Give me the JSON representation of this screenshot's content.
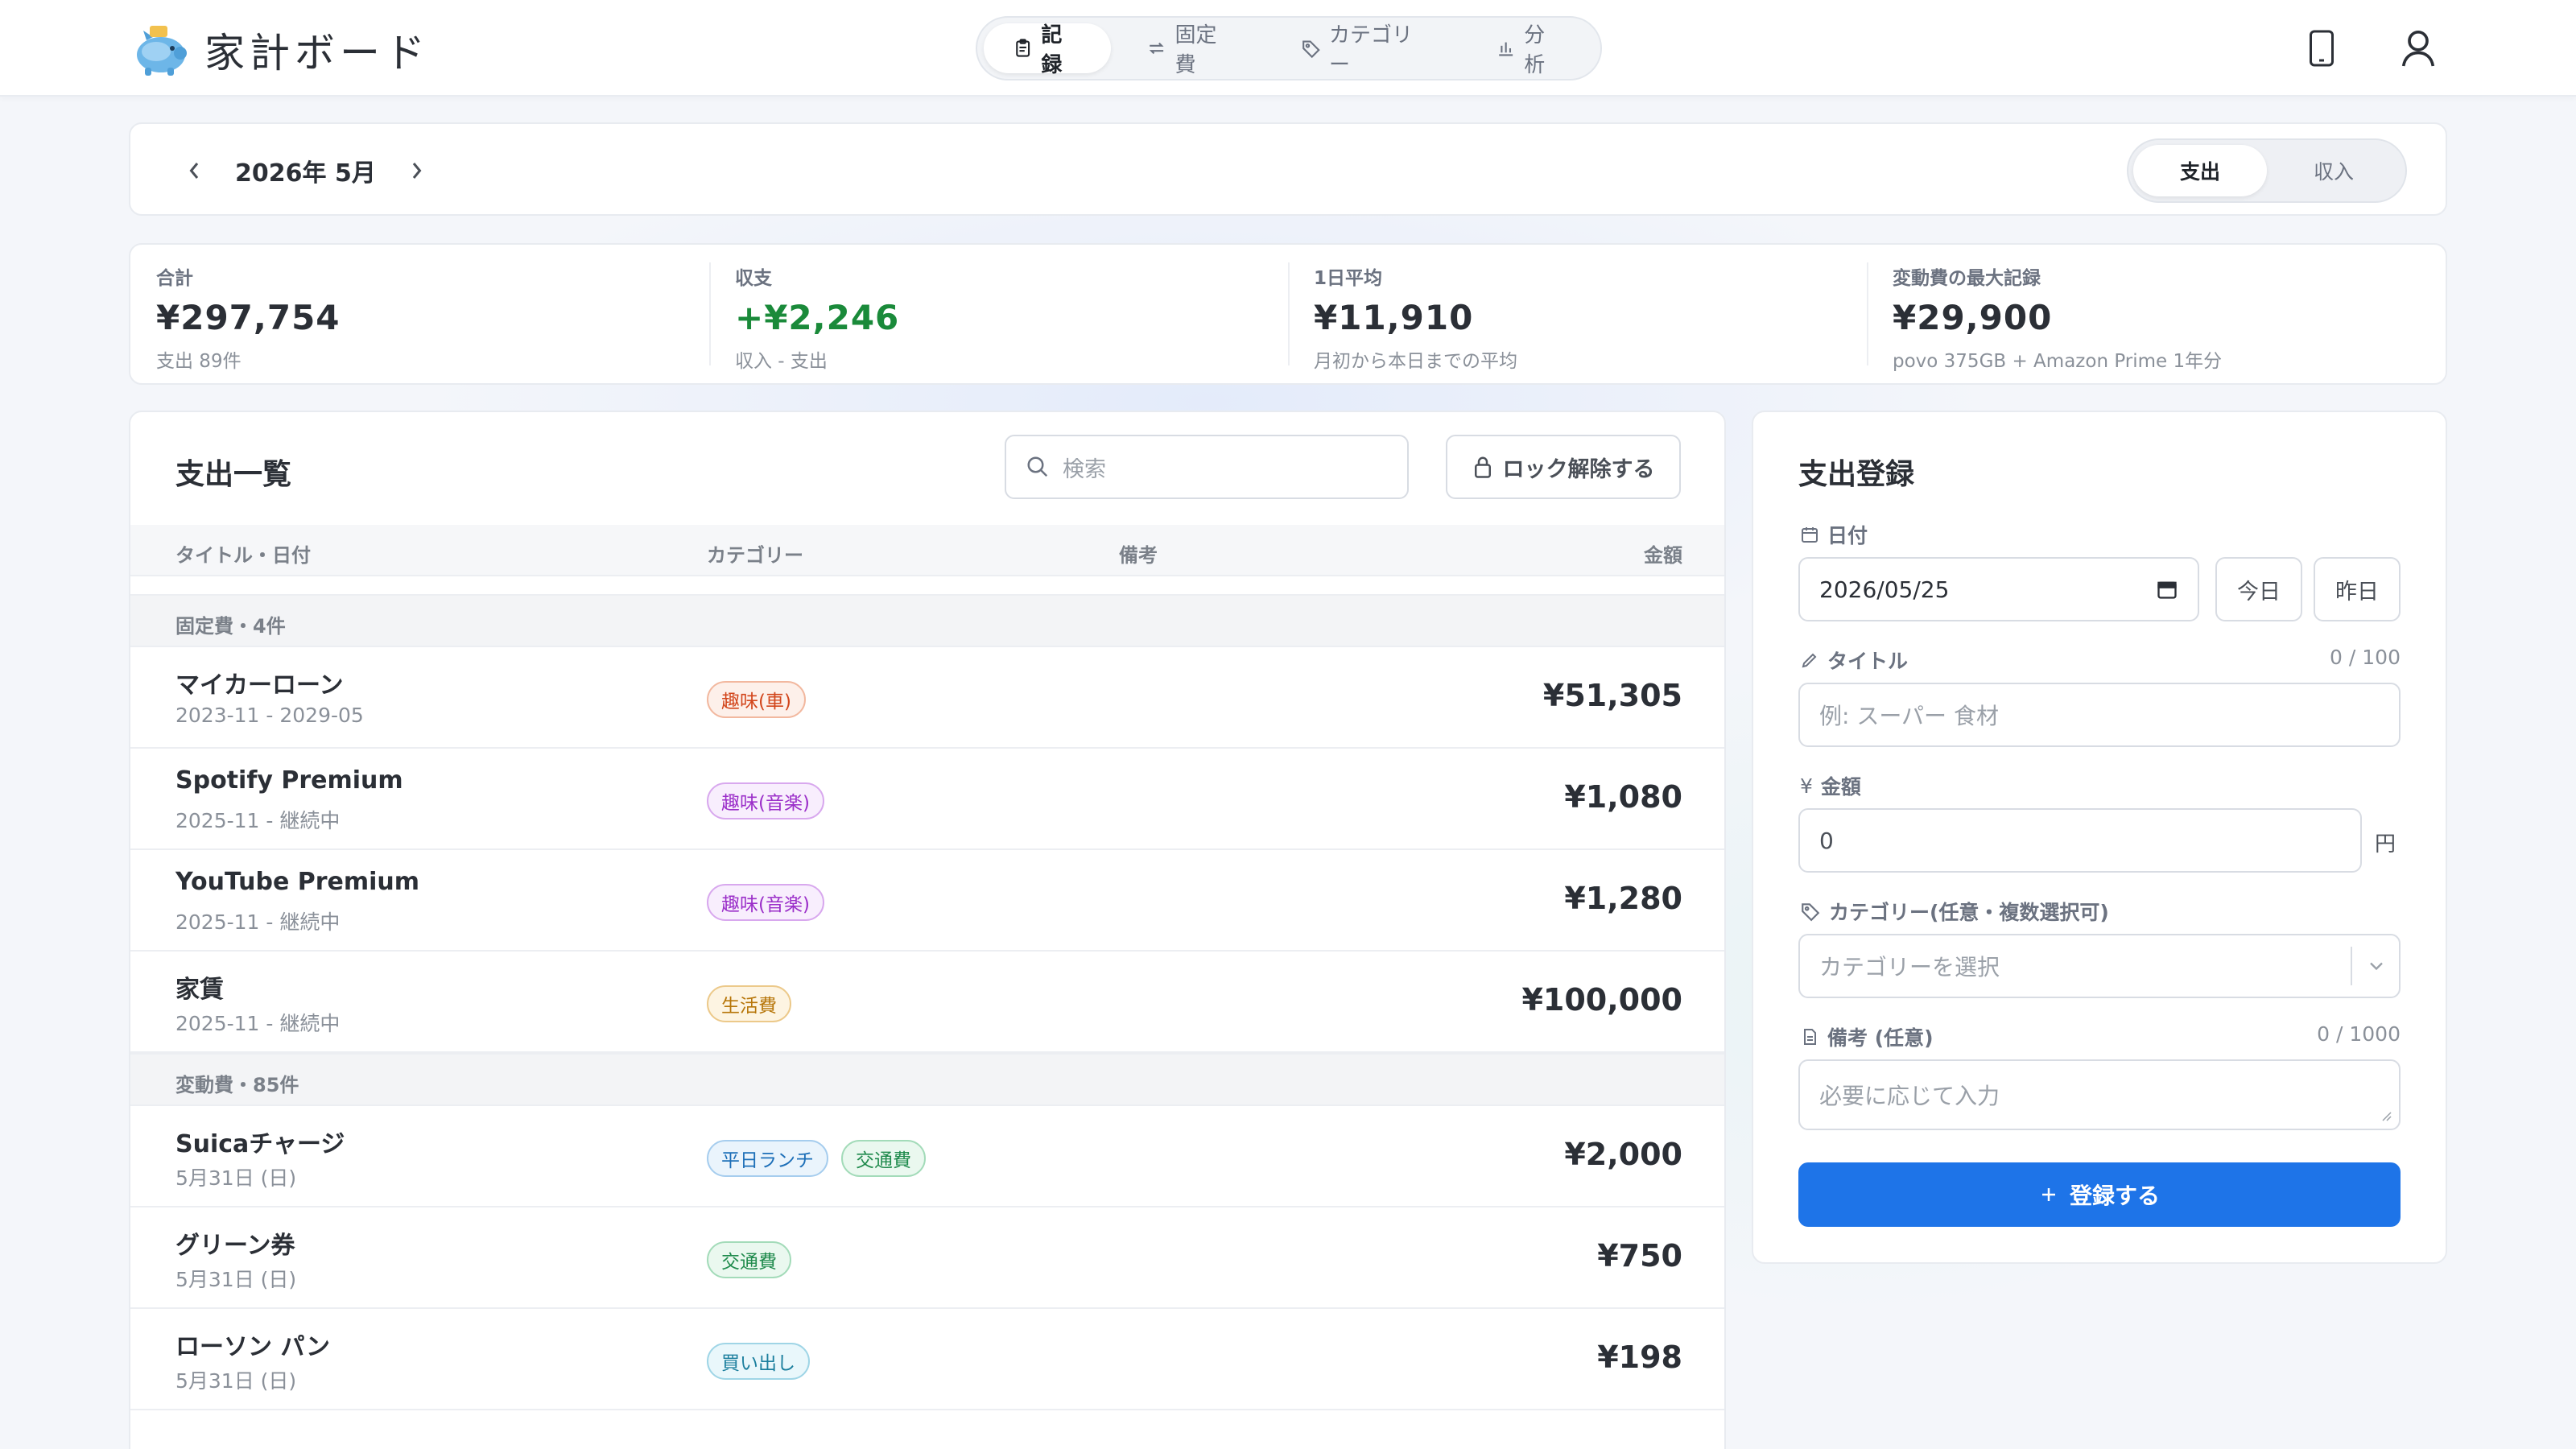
{
  "app": {
    "title": "家計ボード"
  },
  "nav": {
    "tabs": [
      {
        "label": "記録",
        "icon": "clipboard-icon",
        "active": true
      },
      {
        "label": "固定費",
        "icon": "repeat-icon",
        "active": false
      },
      {
        "label": "カテゴリー",
        "icon": "tag-icon",
        "active": false
      },
      {
        "label": "分析",
        "icon": "bar-chart-icon",
        "active": false
      }
    ]
  },
  "header_icons": [
    "mobile-icon",
    "user-icon"
  ],
  "month": {
    "label": "2026年 5月"
  },
  "mode": {
    "expense": "支出",
    "income": "収入",
    "active": "expense"
  },
  "stats": [
    {
      "label": "合計",
      "value": "¥297,754",
      "sub": "支出 89件"
    },
    {
      "label": "収支",
      "value": "+¥2,246",
      "sub": "収入 - 支出"
    },
    {
      "label": "1日平均",
      "value": "¥11,910",
      "sub": "月初から本日までの平均"
    },
    {
      "label": "変動費の最大記録",
      "value": "¥29,900",
      "sub": "povo 375GB + Amazon Prime 1年分"
    }
  ],
  "list": {
    "title": "支出一覧",
    "search_placeholder": "検索",
    "unlock_label": "ロック解除する",
    "columns": {
      "title": "タイトル・日付",
      "category": "カテゴリー",
      "note": "備考",
      "amount": "金額"
    },
    "fixed_group": "固定費・4件",
    "fixed_rows": [
      {
        "title": "マイカーローン",
        "date": "2023-11 - 2029-05",
        "tags": [
          "趣味(車)"
        ],
        "amount": "¥51,305"
      },
      {
        "title": "Spotify Premium",
        "date": "2025-11 - 継続中",
        "tags": [
          "趣味(音楽)"
        ],
        "amount": "¥1,080"
      },
      {
        "title": "YouTube Premium",
        "date": "2025-11 - 継続中",
        "tags": [
          "趣味(音楽)"
        ],
        "amount": "¥1,280"
      },
      {
        "title": "家賃",
        "date": "2025-11 - 継続中",
        "tags": [
          "生活費"
        ],
        "amount": "¥100,000"
      }
    ],
    "variable_group": "変動費・85件",
    "variable_rows": [
      {
        "title": "Suicaチャージ",
        "date": "5月31日 (日)",
        "tags": [
          "平日ランチ",
          "交通費"
        ],
        "amount": "¥2,000"
      },
      {
        "title": "グリーン券",
        "date": "5月31日 (日)",
        "tags": [
          "交通費"
        ],
        "amount": "¥750"
      },
      {
        "title": "ローソン パン",
        "date": "5月31日 (日)",
        "tags": [
          "買い出し"
        ],
        "amount": "¥198"
      }
    ]
  },
  "tag_colors": {
    "趣味(車)": {
      "fg": "#d2461c",
      "bg": "#fdf0ea",
      "border": "#f2b89f"
    },
    "趣味(音楽)": {
      "fg": "#9b2fc9",
      "bg": "#f8eefd",
      "border": "#d8a8ee"
    },
    "生活費": {
      "fg": "#b7760a",
      "bg": "#fdf4e2",
      "border": "#ecc98a"
    },
    "平日ランチ": {
      "fg": "#1d6fb8",
      "bg": "#eaf4fc",
      "border": "#a6cdee"
    },
    "交通費": {
      "fg": "#1f8a4c",
      "bg": "#eaf8ef",
      "border": "#a3dbb9"
    },
    "買い出し": {
      "fg": "#1c7f9e",
      "bg": "#e9f7fb",
      "border": "#9fd5e6"
    }
  },
  "form": {
    "title": "支出登録",
    "date_label": "日付",
    "date_value": "2026/05/25",
    "today_label": "今日",
    "yesterday_label": "昨日",
    "title_label": "タイトル",
    "title_count": "0 / 100",
    "title_placeholder": "例: スーパー 食材",
    "amount_label": "金額",
    "amount_value": "0",
    "amount_unit": "円",
    "category_label": "カテゴリー(任意・複数選択可)",
    "category_placeholder": "カテゴリーを選択",
    "note_label": "備考 (任意)",
    "note_count": "0 / 1000",
    "note_placeholder": "必要に応じて入力",
    "submit_label": "登録する"
  }
}
